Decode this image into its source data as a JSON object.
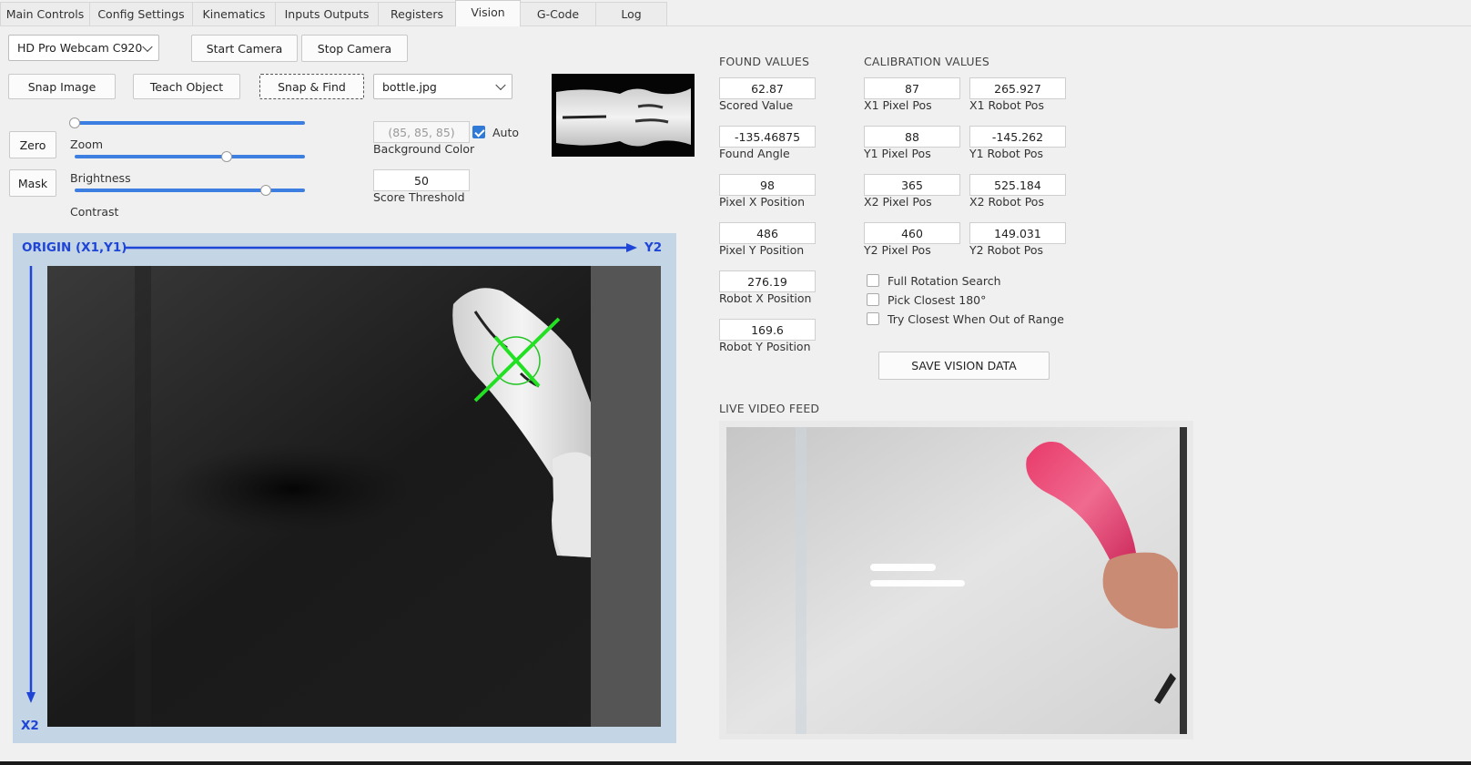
{
  "tabs": [
    "Main Controls",
    "Config Settings",
    "Kinematics",
    "Inputs Outputs",
    "Registers",
    "Vision",
    "G-Code",
    "Log"
  ],
  "active_tab": "Vision",
  "camera": {
    "selected": "HD Pro Webcam C920",
    "start_label": "Start Camera",
    "stop_label": "Stop Camera"
  },
  "actions": {
    "snap_image": "Snap Image",
    "teach_object": "Teach Object",
    "snap_find": "Snap & Find",
    "template_file": "bottle.jpg"
  },
  "controls": {
    "zero_label": "Zero",
    "mask_label": "Mask",
    "zoom_label": "Zoom",
    "brightness_label": "Brightness",
    "contrast_label": "Contrast",
    "zoom_level": 0.0,
    "brightness_level": 0.66,
    "contrast_level": 0.83,
    "background_color": "(85, 85, 85)",
    "background_color_label": "Background Color",
    "auto_label": "Auto",
    "auto_checked": true,
    "score_threshold": "50",
    "score_threshold_label": "Score Threshold"
  },
  "frame": {
    "origin_label": "ORIGIN (X1,Y1)",
    "y2_label": "Y2",
    "x2_label": "X2",
    "axis_color": "#1f45d6"
  },
  "found_values": {
    "header": "FOUND VALUES",
    "items": [
      {
        "value": "62.87",
        "label": "Scored Value"
      },
      {
        "value": "-135.46875",
        "label": "Found Angle"
      },
      {
        "value": "98",
        "label": "Pixel X Position"
      },
      {
        "value": "486",
        "label": "Pixel Y Position"
      },
      {
        "value": "276.19",
        "label": "Robot X Position"
      },
      {
        "value": "169.6",
        "label": "Robot Y Position"
      }
    ]
  },
  "calibration": {
    "header": "CALIBRATION VALUES",
    "rows": [
      {
        "pixel_value": "87",
        "pixel_label": "X1 Pixel Pos",
        "robot_value": "265.927",
        "robot_label": "X1 Robot Pos"
      },
      {
        "pixel_value": "88",
        "pixel_label": "Y1 Pixel Pos",
        "robot_value": "-145.262",
        "robot_label": "Y1 Robot Pos"
      },
      {
        "pixel_value": "365",
        "pixel_label": "X2 Pixel Pos",
        "robot_value": "525.184",
        "robot_label": "X2 Robot Pos"
      },
      {
        "pixel_value": "460",
        "pixel_label": "Y2 Pixel Pos",
        "robot_value": "149.031",
        "robot_label": "Y2 Robot Pos"
      }
    ]
  },
  "options": [
    {
      "label": "Full Rotation Search",
      "checked": false
    },
    {
      "label": "Pick Closest 180°",
      "checked": false
    },
    {
      "label": "Try Closest When Out of Range",
      "checked": false
    }
  ],
  "save_label": "SAVE VISION DATA",
  "live_feed_label": "LIVE VIDEO FEED"
}
